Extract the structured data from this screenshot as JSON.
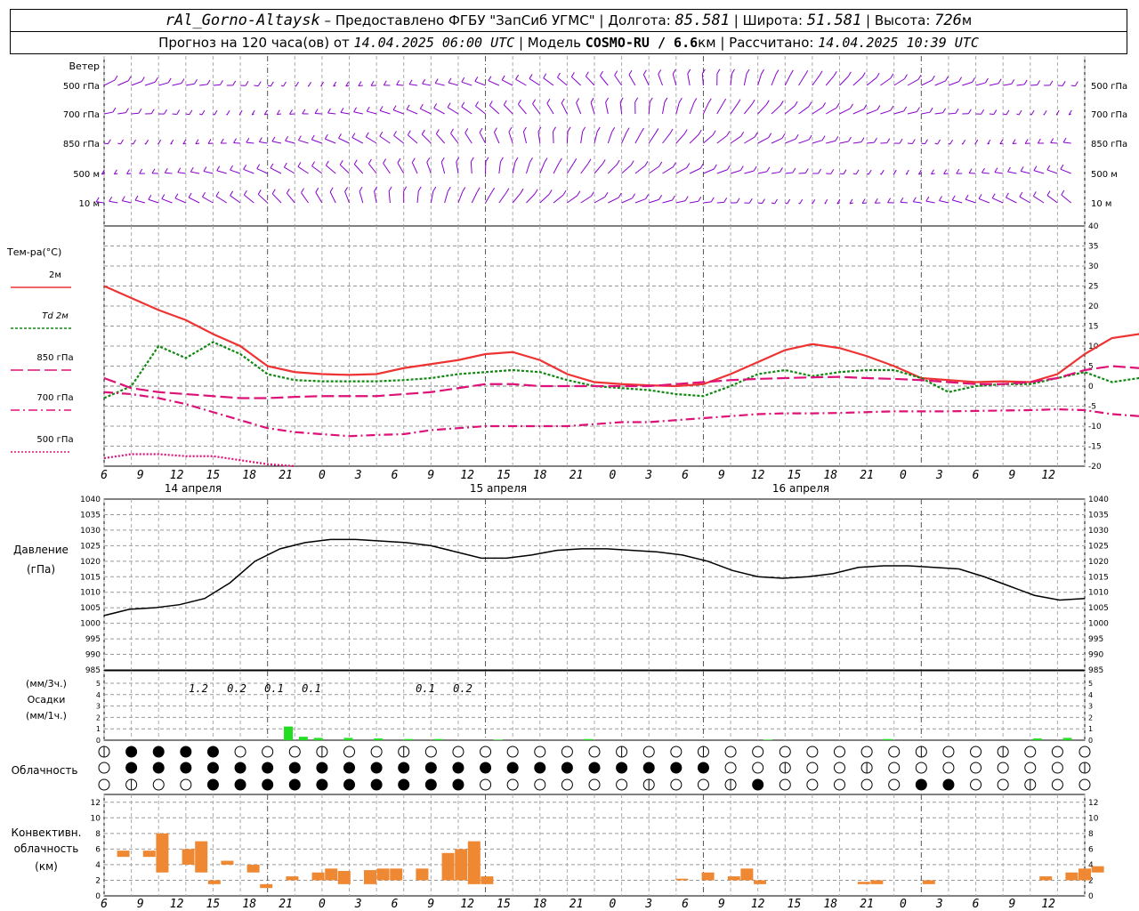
{
  "header": {
    "station": "rAl_Gorno-Altaysk",
    "provider": "Предоставлено ФГБУ \"ЗапСиб УГМС\"",
    "lon_label": "Долгота:",
    "lon": "85.581",
    "lat_label": "Широта:",
    "lat": "51.581",
    "alt_label": "Высота:",
    "alt": "726",
    "alt_unit": "м",
    "forecast_label": "Прогноз на 120 часа(ов) от",
    "forecast_time": "14.04.2025 06:00 UTC",
    "model_label": "Модель",
    "model": "COSMO-RU / 6.6",
    "model_unit": "км",
    "computed_label": "Рассчитано:",
    "computed_time": "14.04.2025 10:39 UTC"
  },
  "labels": {
    "wind": "Ветер",
    "wind_levels": [
      "500 гПа",
      "700 гПа",
      "850 гПа",
      "500 м",
      "10 м"
    ],
    "temp_title": "Тем-ра(°С)",
    "temp_legend": [
      "2м",
      "Td 2м",
      "850 гПа",
      "700 гПа",
      "500 гПа"
    ],
    "pressure_title": "Давление",
    "pressure_unit": "(гПа)",
    "precip_3h": "(мм/3ч.)",
    "precip_title": "Осадки",
    "precip_1h": "(мм/1ч.)",
    "cloud_title": "Облачность",
    "conv_title1": "Конвективн.",
    "conv_title2": "облачность",
    "conv_unit": "(км)"
  },
  "colors": {
    "t2m": "#ee3333",
    "td2m": "#118811",
    "t850": "#dd1177",
    "t700": "#dd1177",
    "t500": "#dd1177",
    "wind": "#8800cc",
    "precip": "#22dd22",
    "conv": "#ee8833"
  },
  "chart_data": [
    {
      "type": "line",
      "name": "temperature",
      "x_hours": [
        0,
        3,
        6,
        9,
        12,
        15,
        18,
        21,
        24,
        27,
        30,
        33,
        36,
        39,
        42,
        45,
        48,
        51,
        54,
        57,
        60,
        63,
        66,
        69,
        72,
        75,
        78,
        81,
        84,
        87,
        90,
        93,
        96,
        99,
        102,
        105,
        108,
        111,
        114
      ],
      "series": [
        {
          "name": "2м",
          "values": [
            25,
            22,
            19,
            16.5,
            13,
            10,
            5,
            3.5,
            3,
            2.8,
            3,
            4.5,
            5.5,
            6.5,
            8,
            8.5,
            6.5,
            3,
            1,
            0.5,
            0.2,
            0,
            0.5,
            3,
            6,
            9,
            10.5,
            9.5,
            7.5,
            5,
            2,
            1.5,
            1,
            1.2,
            1,
            3,
            8,
            12,
            13
          ]
        },
        {
          "name": "Td 2м",
          "values": [
            -3,
            0,
            10,
            7,
            11,
            8,
            3,
            1.5,
            1.2,
            1.2,
            1.2,
            1.5,
            2,
            3,
            3.5,
            4,
            3.5,
            1.5,
            0,
            -0.5,
            -1,
            -2,
            -2.5,
            0,
            3,
            4,
            2.5,
            3.5,
            4,
            4,
            2,
            -1.5,
            0,
            0.5,
            0.5,
            2,
            3.5,
            1,
            2
          ]
        },
        {
          "name": "850 гПа",
          "values": [
            2,
            -0.5,
            -1.5,
            -2,
            -2.5,
            -3,
            -3,
            -2.7,
            -2.5,
            -2.5,
            -2.5,
            -2,
            -1.5,
            -0.5,
            0.5,
            0.5,
            0,
            0,
            0,
            0,
            0,
            0.5,
            1,
            1.5,
            1.8,
            2,
            2.2,
            2.3,
            2,
            1.8,
            1.5,
            1,
            0.5,
            0.5,
            1,
            2,
            4,
            5,
            4.5
          ]
        },
        {
          "name": "700 гПа",
          "values": [
            -1.5,
            -2,
            -3,
            -4.5,
            -6.5,
            -8.5,
            -10.5,
            -11.5,
            -12,
            -12.5,
            -12.2,
            -12,
            -11,
            -10.5,
            -10,
            -10,
            -10,
            -10,
            -9.5,
            -9,
            -9,
            -8.5,
            -8,
            -7.5,
            -7,
            -6.8,
            -6.8,
            -6.7,
            -6.5,
            -6.3,
            -6.3,
            -6.3,
            -6.2,
            -6.1,
            -6,
            -5.8,
            -6,
            -7,
            -7.5
          ]
        },
        {
          "name": "500 гПа",
          "values": [
            -18,
            -17,
            -17,
            -17.5,
            -17.5,
            -18.5,
            -19.5,
            -20
          ]
        }
      ],
      "ylim": [
        -20,
        40
      ]
    },
    {
      "type": "line",
      "name": "pressure",
      "x_hours": [
        0,
        3,
        6,
        9,
        12,
        15,
        18,
        21,
        24,
        27,
        30,
        33,
        36,
        39,
        42,
        45,
        48,
        51,
        54,
        57,
        60,
        63,
        66,
        69,
        72,
        75,
        78,
        81,
        84,
        87,
        90,
        93,
        96,
        99,
        102,
        105,
        108,
        111,
        114,
        117
      ],
      "values": [
        1002.5,
        1004.5,
        1005,
        1006,
        1008,
        1013,
        1020,
        1024,
        1026,
        1027,
        1027,
        1026.5,
        1026,
        1025,
        1023,
        1021,
        1021,
        1022,
        1023.5,
        1024,
        1024,
        1023.5,
        1023,
        1022,
        1020,
        1017,
        1015,
        1014.5,
        1015,
        1016,
        1018,
        1018.5,
        1018.5,
        1018,
        1017.5,
        1015,
        1012,
        1009,
        1007.5,
        1008
      ],
      "ylim": [
        985,
        1040
      ]
    },
    {
      "type": "bar",
      "name": "precipitation",
      "labels_3h": [
        "1.2",
        "0.2",
        "0.1",
        "0.1",
        "0.1",
        "0.2"
      ],
      "ylim": [
        0,
        5
      ]
    },
    {
      "type": "bar",
      "name": "convective_cloud",
      "ylim": [
        0,
        13
      ]
    }
  ],
  "axes": {
    "hour_ticks": [
      "6",
      "9",
      "12",
      "15",
      "18",
      "21",
      "0",
      "3",
      "6",
      "9",
      "12",
      "15",
      "18",
      "21",
      "0",
      "3",
      "6",
      "9",
      "12",
      "15",
      "18",
      "21",
      "0",
      "3",
      "6",
      "9",
      "12"
    ],
    "day_labels": [
      "14 апреля",
      "15 апреля",
      "16 апреля"
    ],
    "temp_ticks": [
      "40",
      "35",
      "30",
      "25",
      "20",
      "15",
      "10",
      "5",
      "0",
      "-5",
      "-10",
      "-15",
      "-20"
    ],
    "pressure_ticks": [
      "1040",
      "1035",
      "1030",
      "1025",
      "1020",
      "1015",
      "1010",
      "1005",
      "1000",
      "995",
      "990",
      "985"
    ],
    "precip_ticks": [
      "5",
      "4",
      "3",
      "2",
      "1",
      "0"
    ],
    "conv_ticks": [
      "12",
      "10",
      "8",
      "6",
      "4",
      "2",
      "0"
    ]
  }
}
